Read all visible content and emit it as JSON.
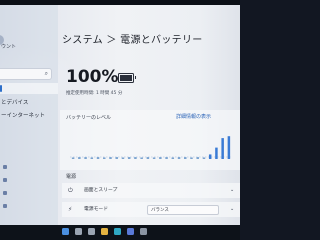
{
  "window": {
    "title": "システム ＞ 電源とバッテリー"
  },
  "sidebar": {
    "account_label": "ウント",
    "search_icon": "search-icon",
    "items": [
      {
        "label": ""
      },
      {
        "label": "とデバイス"
      },
      {
        "label": "ーインターネット"
      },
      {
        "label": ""
      },
      {
        "label": ""
      },
      {
        "label": ""
      }
    ]
  },
  "battery": {
    "percent_text": "100%",
    "percent_value": 100,
    "estimate_text": "推定使用時間: 1 時間 45 分"
  },
  "chart_data": {
    "type": "bar",
    "title": "バッテリーのレベル",
    "link_text": "詳細情報の表示",
    "ylim": [
      0,
      100
    ],
    "values": [
      4,
      5,
      5,
      4,
      5,
      4,
      5,
      5,
      4,
      5,
      5,
      4,
      5,
      4,
      5,
      5,
      4,
      5,
      5,
      4,
      5,
      4,
      12,
      30,
      55,
      60
    ],
    "highlight_from": 22,
    "colors": {
      "low": "#7aa3d0",
      "high": "#3a7bd5"
    }
  },
  "power": {
    "section_label": "電源",
    "rows": [
      {
        "label": "画面とスリープ",
        "value": ""
      },
      {
        "label": "電源モード",
        "sub": "",
        "value": "バランス"
      }
    ]
  },
  "taskbar": {
    "icons": [
      {
        "name": "start-icon",
        "color": "#4a8fe0"
      },
      {
        "name": "search-icon",
        "color": "#9aa4b2"
      },
      {
        "name": "task-view-icon",
        "color": "#9aa4b2"
      },
      {
        "name": "explorer-icon",
        "color": "#e3b341"
      },
      {
        "name": "edge-icon",
        "color": "#2fa8c4"
      },
      {
        "name": "store-icon",
        "color": "#5a7ad9"
      },
      {
        "name": "settings-icon",
        "color": "#8b95a3"
      }
    ]
  }
}
